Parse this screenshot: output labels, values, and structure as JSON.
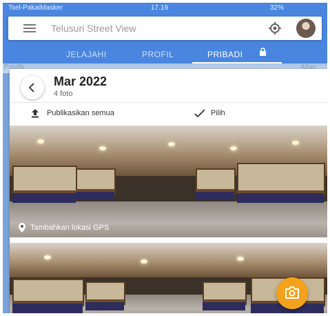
{
  "status_bar": {
    "carrier": "Tsel-PakaiMasker",
    "time": "17.19",
    "battery": "32%"
  },
  "search": {
    "placeholder": "Telusuri Street View"
  },
  "tabs": [
    {
      "label": "JELAJAHI"
    },
    {
      "label": "PROFIL"
    },
    {
      "label": "PRIBADI"
    }
  ],
  "active_tab": "PRIBADI",
  "map_labels": {
    "left": "Pasifik",
    "right": "Atlan"
  },
  "album": {
    "title": "Mar 2022",
    "count": "4 foto"
  },
  "actions": {
    "publish": "Publikasikan semua",
    "select": "Pilih"
  },
  "photos": [
    {
      "gps_label": "Tambahkan lokasi GPS"
    },
    {
      "gps_label": ""
    }
  ],
  "icons": [
    "menu-icon",
    "target-icon",
    "avatar",
    "lock-icon",
    "back-arrow-icon",
    "upload-icon",
    "checkmark-icon",
    "location-pin-icon",
    "camera-icon"
  ],
  "colors": {
    "app_bar": "#4a86e0",
    "fab": "#f4a21c",
    "card": "#ffffff"
  }
}
